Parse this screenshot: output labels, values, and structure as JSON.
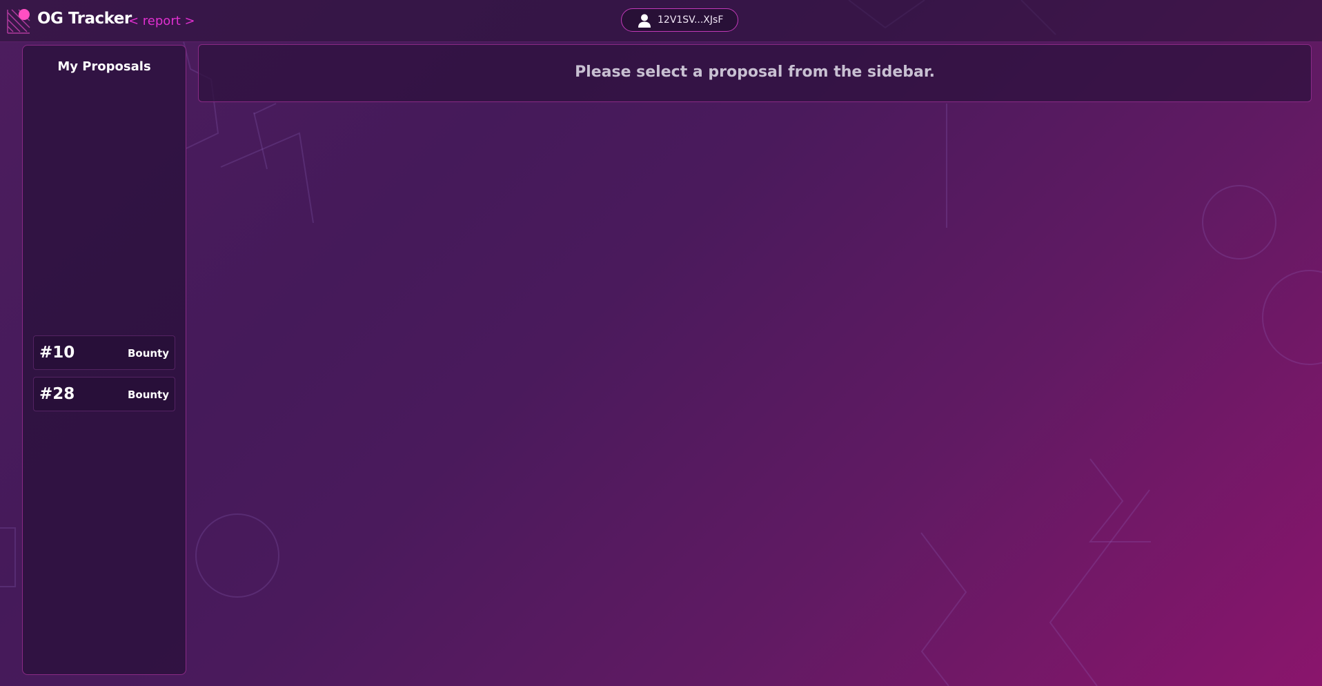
{
  "header": {
    "brand": "OG Tracker",
    "tag": "< report >",
    "wallet_address": "12V1SV...XJsF",
    "icons": {
      "logo": "og-logo-icon",
      "user": "user-icon"
    }
  },
  "sidebar": {
    "title": "My Proposals",
    "items": [
      {
        "number": "#10",
        "type": "Bounty"
      },
      {
        "number": "#28",
        "type": "Bounty"
      }
    ]
  },
  "main": {
    "message": "Please select a proposal from the sidebar."
  },
  "colors": {
    "accent": "#e030d0",
    "border": "#8a2a86",
    "background_start": "#4d1d5e",
    "background_end": "#8a156c"
  }
}
